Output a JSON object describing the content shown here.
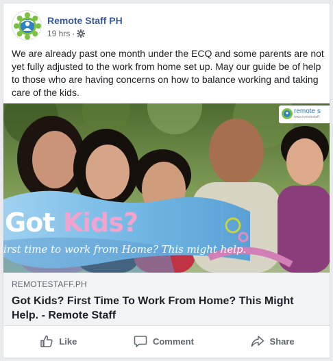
{
  "post": {
    "page_name": "Remote Staff PH",
    "time": "19 hrs",
    "separator": "·",
    "audience_icon": "gear-icon",
    "text": "We are already past one month under the ECQ and some parents are not yet fully adjusted to the work from home set up. May our guide be of help to those who are having concerns on how to balance working and taking care of the kids."
  },
  "link_image": {
    "headline_part1": "Got ",
    "headline_part2": "Kids?",
    "subline": "irst time to work from Home? This might help.",
    "logo_text": "remote s",
    "logo_url": "www.remotestaff.",
    "colors": {
      "headline": "#ffffff",
      "kids": "#f2a4cf",
      "banner": "#8fc6ea"
    }
  },
  "link_preview": {
    "domain": "REMOTESTAFF.PH",
    "title": "Got Kids? First Time To Work From Home? This Might Help. - Remote Staff"
  },
  "actions": [
    {
      "label": "Like",
      "icon": "thumbs-up-icon"
    },
    {
      "label": "Comment",
      "icon": "comment-icon"
    },
    {
      "label": "Share",
      "icon": "share-icon"
    }
  ],
  "colors": {
    "page_name": "#385898",
    "meta": "#616770",
    "caption_bg": "#f2f3f5",
    "action": "#606770"
  }
}
